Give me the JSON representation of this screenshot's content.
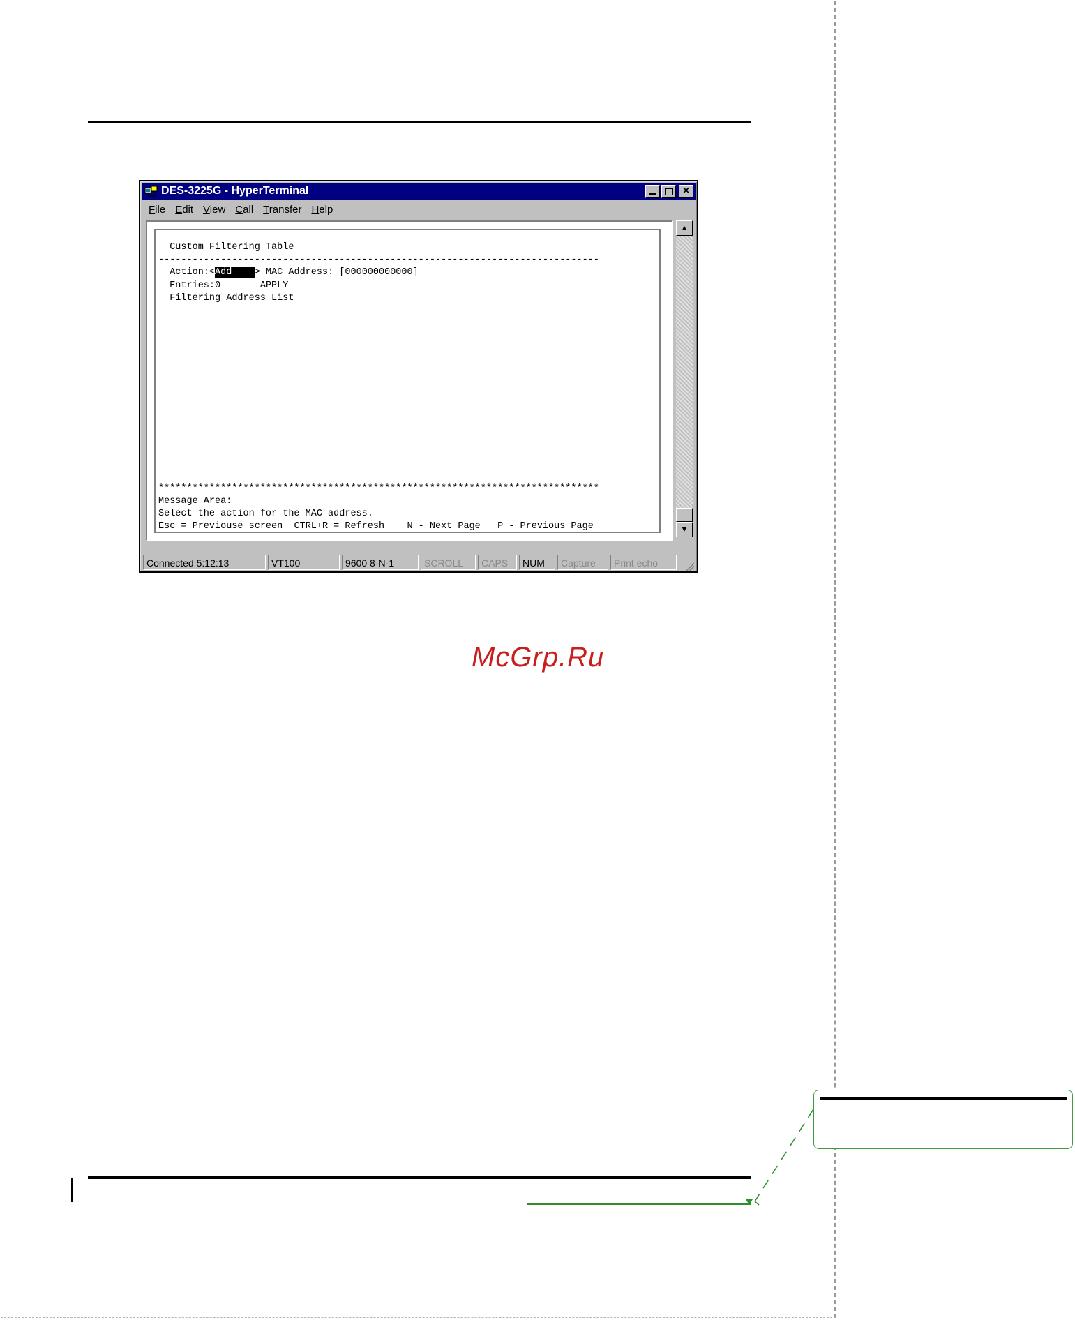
{
  "window": {
    "title": "DES-3225G - HyperTerminal",
    "close_glyph": "×"
  },
  "menubar": {
    "items": [
      {
        "key": "F",
        "rest": "ile"
      },
      {
        "key": "E",
        "rest": "dit"
      },
      {
        "key": "V",
        "rest": "iew"
      },
      {
        "key": "C",
        "rest": "all"
      },
      {
        "key": "T",
        "rest": "ransfer"
      },
      {
        "key": "H",
        "rest": "elp"
      }
    ]
  },
  "terminal": {
    "screen_title": "Custom Filtering Table",
    "divider": "------------------------------------------------------------------------------",
    "action_label": "Action:",
    "action_open": "<",
    "action_value": "Add    ",
    "action_close": ">",
    "mac_label": "MAC Address:",
    "mac_value": "[000000000000]",
    "entries_label": "Entries:0",
    "apply_label": "APPLY",
    "list_label": "Filtering Address List",
    "stars": "******************************************************************************",
    "message_area_label": "Message Area:",
    "message_text": "Select the action for the MAC address.",
    "help_esc": "Esc = Previouse screen",
    "help_refresh": "CTRL+R = Refresh",
    "help_next": "N - Next Page",
    "help_prev": "P - Previous Page"
  },
  "statusbar": {
    "connected": "Connected 5:12:13",
    "emulation": "VT100",
    "settings": "9600 8-N-1",
    "scroll": "SCROLL",
    "caps": "CAPS",
    "num": "NUM",
    "capture": "Capture",
    "print_echo": "Print echo"
  },
  "scrollbar": {
    "up_glyph": "▲",
    "down_glyph": "▼"
  },
  "watermark": {
    "text": "McGrp.Ru"
  },
  "colors": {
    "titlebar": "#000080",
    "watermark": "#c81e1e",
    "comment_border": "#3e9a3e"
  }
}
